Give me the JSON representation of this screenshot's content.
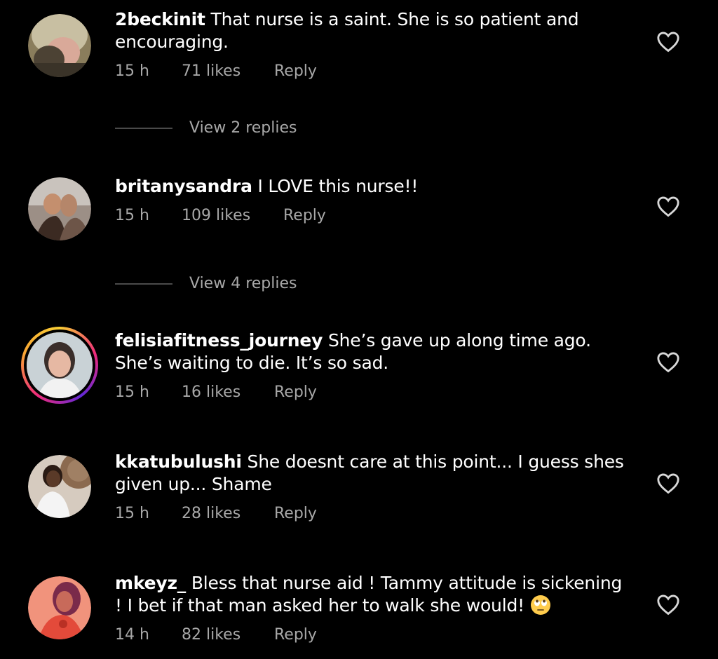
{
  "comments": [
    {
      "username": "2beckinit",
      "text": "That nurse is a saint. She is so patient and encouraging.",
      "time": "15 h",
      "likes": "71 likes",
      "reply": "Reply",
      "view_replies": "View 2 replies"
    },
    {
      "username": "britanysandra",
      "text": "I LOVE this nurse!!",
      "time": "15 h",
      "likes": "109 likes",
      "reply": "Reply",
      "view_replies": "View 4 replies"
    },
    {
      "username": "felisiafitness_journey",
      "text": "She’s gave up along time ago. She’s waiting to die. It’s so sad.",
      "time": "15 h",
      "likes": "16 likes",
      "reply": "Reply"
    },
    {
      "username": "kkatubulushi",
      "text": "She doesnt care at this point... I guess shes given up... Shame",
      "time": "15 h",
      "likes": "28 likes",
      "reply": "Reply"
    },
    {
      "username": "mkeyz_",
      "text": "Bless that nurse aid ! Tammy attitude is sickening ! I bet if that man asked her to walk she would!",
      "time": "14 h",
      "likes": "82 likes",
      "reply": "Reply",
      "emoji": "face-with-rolling-eyes"
    }
  ],
  "colors": {
    "background": "#000000",
    "text": "#ffffff",
    "secondary": "#a8a8a8"
  }
}
